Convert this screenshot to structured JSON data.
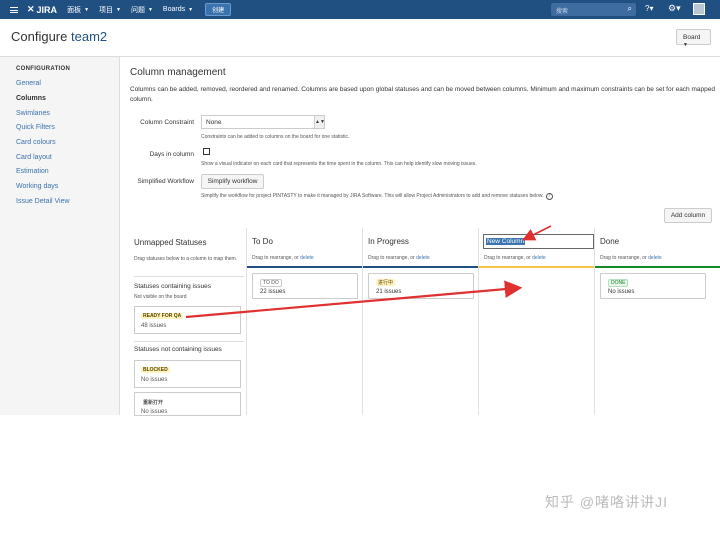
{
  "topnav": {
    "logo": "JIRA",
    "items": [
      "面板",
      "项目",
      "问题",
      "Boards"
    ],
    "create_label": "创建",
    "search_placeholder": "搜索"
  },
  "header": {
    "title_prefix": "Configure",
    "project": "team2",
    "board_button": "Board"
  },
  "sidebar": {
    "heading": "CONFIGURATION",
    "items": [
      "General",
      "Columns",
      "Swimlanes",
      "Quick Filters",
      "Card colours",
      "Card layout",
      "Estimation",
      "Working days",
      "Issue Detail View"
    ],
    "active_index": 1
  },
  "main": {
    "title": "Column management",
    "description": "Columns can be added, removed, reordered and renamed. Columns are based upon global statuses and can be moved between columns. Minimum and maximum constraints can be set for each mapped column.",
    "column_constraint": {
      "label": "Column Constraint",
      "value": "None",
      "hint": "Constraints can be added to columns on the board for one statistic."
    },
    "days_in_column": {
      "label": "Days in column",
      "checked": false,
      "hint": "Show a visual indicator on each card that represents the time spent in the column. This can help identify slow moving issues."
    },
    "simplified_workflow": {
      "label": "Simplified Workflow",
      "button": "Simplify workflow",
      "hint": "Simplify the workflow for project PINTASTY to make it managed by JIRA Software. This will allow Project Administrators to add and remove statuses below."
    },
    "add_column": "Add column"
  },
  "unmapped": {
    "title": "Unmapped Statuses",
    "hint": "Drag statuses below to a column to map them.",
    "containing_title": "Statuses containing issues",
    "containing_sub": "Not visible on the board",
    "containing": [
      {
        "status": "READY FOR QA",
        "count": "48 issues"
      }
    ],
    "not_containing_title": "Statuses not containing issues",
    "not_containing": [
      {
        "status": "BLOCKED",
        "count": "No issues"
      },
      {
        "status": "重新打开",
        "count": "No issues"
      }
    ]
  },
  "columns": [
    {
      "name": "To Do",
      "hint": "Drag to rearrange, or",
      "delete": "delete",
      "bar_color": "#205081",
      "status": "TO DO",
      "count": "22 issues",
      "lozenge_bg": "#ffffff",
      "lozenge_fg": "#555555"
    },
    {
      "name": "In Progress",
      "hint": "Drag to rearrange, or",
      "delete": "delete",
      "bar_color": "#205081",
      "status": "进行中",
      "count": "21 issues",
      "lozenge_bg": "#fff3c0",
      "lozenge_fg": "#594300"
    },
    {
      "name": "New Column",
      "hint": "Drag to rearrange, or",
      "delete": "delete",
      "bar_color": "#f6c342"
    },
    {
      "name": "Done",
      "hint": "Drag to rearrange, or",
      "delete": "delete",
      "bar_color": "#14892c",
      "status": "DONE",
      "count": "No issues",
      "lozenge_bg": "#e8f5e9",
      "lozenge_fg": "#14892c"
    }
  ],
  "colors": {
    "nav": "#205081",
    "link": "#3b73af",
    "annotation_arrow": "#e03030"
  },
  "watermark": "知乎 @啫咯讲讲JI"
}
